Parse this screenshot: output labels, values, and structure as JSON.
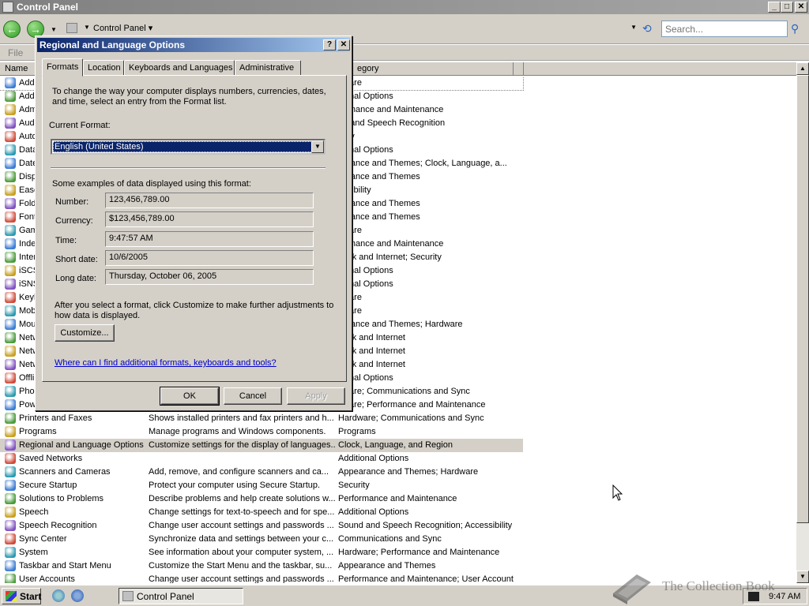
{
  "window": {
    "title": "Control Panel",
    "minimize": "_",
    "maximize": "□",
    "close": "✕"
  },
  "nav": {
    "back_glyph": "←",
    "forward_glyph": "→",
    "dropdown_glyph": "▼",
    "address_crumb": "Control Panel ▾",
    "search_placeholder": "Search..."
  },
  "menu": {
    "file": "File"
  },
  "columns": {
    "name": "Name",
    "category": "egory"
  },
  "rows": [
    {
      "name": "Add",
      "desc": "",
      "cat": "dware",
      "icon": "add-hardware-icon"
    },
    {
      "name": "Add",
      "desc": "",
      "cat": "itional Options",
      "icon": "add-programs-icon"
    },
    {
      "name": "Adm",
      "desc": "",
      "cat": "formance and Maintenance",
      "icon": "admin-tools-icon"
    },
    {
      "name": "Aud",
      "desc": "",
      "cat": "nd and Speech Recognition",
      "icon": "audio-icon"
    },
    {
      "name": "Auto",
      "desc": "",
      "cat": "urity",
      "icon": "automatic-updates-icon"
    },
    {
      "name": "Data",
      "desc": "",
      "cat": "itional Options",
      "icon": "data-sources-icon"
    },
    {
      "name": "Date",
      "desc": "",
      "cat": "earance and Themes; Clock, Language, a...",
      "icon": "date-time-icon"
    },
    {
      "name": "Disp",
      "desc": "",
      "cat": "earance and Themes",
      "icon": "display-icon"
    },
    {
      "name": "Ease",
      "desc": "",
      "cat": "essibility",
      "icon": "ease-of-access-icon"
    },
    {
      "name": "Fold",
      "desc": "",
      "cat": "earance and Themes",
      "icon": "folder-options-icon"
    },
    {
      "name": "Font",
      "desc": "",
      "cat": "earance and Themes",
      "icon": "fonts-icon"
    },
    {
      "name": "Gam",
      "desc": "",
      "cat": "dware",
      "icon": "game-controllers-icon"
    },
    {
      "name": "Inde",
      "desc": "",
      "cat": "formance and Maintenance",
      "icon": "indexing-icon"
    },
    {
      "name": "Inter",
      "desc": "",
      "cat": "work and Internet; Security",
      "icon": "internet-options-icon"
    },
    {
      "name": "iSCS",
      "desc": "",
      "cat": "itional Options",
      "icon": "iscsi-icon"
    },
    {
      "name": "iSNS",
      "desc": "",
      "cat": "itional Options",
      "icon": "isns-icon"
    },
    {
      "name": "Keyl",
      "desc": "",
      "cat": "dware",
      "icon": "keyboard-icon"
    },
    {
      "name": "Mob",
      "desc": "",
      "cat": "dware",
      "icon": "mobile-pc-icon"
    },
    {
      "name": "Mou",
      "desc": "",
      "cat": "earance and Themes; Hardware",
      "icon": "mouse-icon"
    },
    {
      "name": "Netw",
      "desc": "",
      "cat": "work and Internet",
      "icon": "network-icon"
    },
    {
      "name": "Netw",
      "desc": "",
      "cat": "work and Internet",
      "icon": "network-2-icon"
    },
    {
      "name": "Netw",
      "desc": "",
      "cat": "work and Internet",
      "icon": "network-3-icon"
    },
    {
      "name": "Offli",
      "desc": "",
      "cat": "itional Options",
      "icon": "offline-files-icon"
    },
    {
      "name": "Pho",
      "desc": "",
      "cat": "dware; Communications and Sync",
      "icon": "phone-icon"
    },
    {
      "name": "Pow",
      "desc": "",
      "cat": "dware; Performance and Maintenance",
      "icon": "power-icon"
    },
    {
      "name": "Printers and Faxes",
      "desc": "Shows installed printers and fax printers and h...",
      "cat": "Hardware; Communications and Sync",
      "icon": "printer-icon"
    },
    {
      "name": "Programs",
      "desc": "Manage programs and Windows components.",
      "cat": "Programs",
      "icon": "programs-icon"
    },
    {
      "name": "Regional and Language Options",
      "desc": "Customize settings for the display of languages...",
      "cat": "Clock, Language, and Region",
      "icon": "globe-icon",
      "selected": true
    },
    {
      "name": "Saved Networks",
      "desc": "",
      "cat": "Additional Options",
      "icon": "saved-networks-icon"
    },
    {
      "name": "Scanners and Cameras",
      "desc": "Add, remove, and configure scanners and ca...",
      "cat": "Appearance and Themes; Hardware",
      "icon": "scanner-icon"
    },
    {
      "name": "Secure Startup",
      "desc": "Protect your computer using Secure Startup.",
      "cat": "Security",
      "icon": "secure-startup-icon"
    },
    {
      "name": "Solutions to Problems",
      "desc": "Describe problems and help create solutions w...",
      "cat": "Performance and Maintenance",
      "icon": "solutions-icon"
    },
    {
      "name": "Speech",
      "desc": "Change settings for text-to-speech and for spe...",
      "cat": "Additional Options",
      "icon": "speech-icon"
    },
    {
      "name": "Speech Recognition",
      "desc": "Change user account settings and passwords ...",
      "cat": "Sound and Speech Recognition; Accessibility",
      "icon": "speech-recognition-icon"
    },
    {
      "name": "Sync Center",
      "desc": "Synchronize data and settings between your c...",
      "cat": "Communications and Sync",
      "icon": "sync-icon"
    },
    {
      "name": "System",
      "desc": "See information about your computer system, ...",
      "cat": "Hardware; Performance and Maintenance",
      "icon": "system-icon"
    },
    {
      "name": "Taskbar and Start Menu",
      "desc": "Customize the Start Menu and the taskbar, su...",
      "cat": "Appearance and Themes",
      "icon": "taskbar-icon"
    },
    {
      "name": "User Accounts",
      "desc": "Change user account settings and passwords ...",
      "cat": "Performance and Maintenance; User Account",
      "icon": "user-accounts-icon"
    }
  ],
  "dialog": {
    "title": "Regional and Language Options",
    "help": "?",
    "close": "✕",
    "tabs": [
      "Formats",
      "Location",
      "Keyboards and Languages",
      "Administrative"
    ],
    "intro": "To change the way your computer displays numbers, currencies, dates, and time, select an entry from the Format list.",
    "current_format_label": "Current Format:",
    "current_format_value": "English (United States)",
    "examples_heading": "Some examples of data displayed using this format:",
    "fields": [
      {
        "label": "Number:",
        "value": "123,456,789.00"
      },
      {
        "label": "Currency:",
        "value": "$123,456,789.00"
      },
      {
        "label": "Time:",
        "value": "9:47:57 AM"
      },
      {
        "label": "Short date:",
        "value": "10/6/2005"
      },
      {
        "label": "Long date:",
        "value": "Thursday, October 06, 2005"
      }
    ],
    "customize_note": "After you select a format, click Customize to make further adjustments to how data is displayed.",
    "customize_button": "Customize...",
    "help_link": "Where can I find additional formats, keyboards and tools?",
    "ok": "OK",
    "cancel": "Cancel",
    "apply": "Apply"
  },
  "taskbar": {
    "start": "Start",
    "task": "Control Panel",
    "clock": "9:47 AM"
  },
  "watermark": "The Collection Book"
}
